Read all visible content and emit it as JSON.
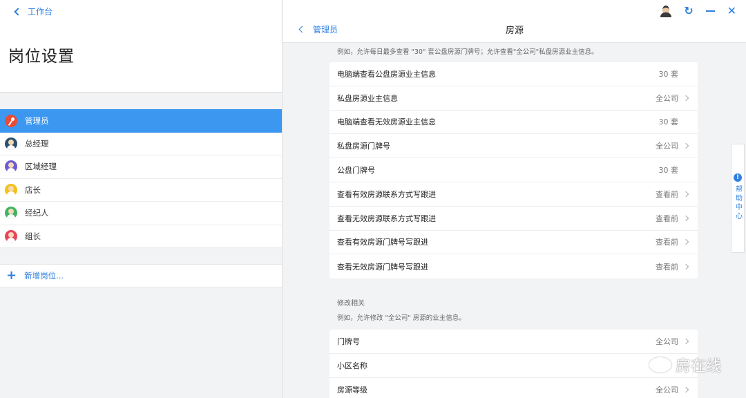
{
  "left": {
    "back_label": "工作台",
    "title": "岗位设置",
    "roles": [
      {
        "label": "管理员",
        "avatar": "key-icon",
        "active": true
      },
      {
        "label": "总经理",
        "avatar": "manager-avatar-icon",
        "active": false
      },
      {
        "label": "区域经理",
        "avatar": "area-manager-avatar-icon",
        "active": false
      },
      {
        "label": "店长",
        "avatar": "store-manager-avatar-icon",
        "active": false
      },
      {
        "label": "经纪人",
        "avatar": "agent-avatar-icon",
        "active": false
      },
      {
        "label": "组长",
        "avatar": "team-leader-avatar-icon",
        "active": false
      }
    ],
    "add_label": "新增岗位..."
  },
  "right": {
    "back_label": "管理员",
    "title": "房源",
    "hint_top": "例如，允许每日最多查看 \"30\" 套公盘房源门牌号；允许查看\"全公司\"私盘房源业主信息。",
    "view_items": [
      {
        "label": "电脑端查看公盘房源业主信息",
        "value": "30 套"
      },
      {
        "label": "私盘房源业主信息",
        "value": "全公司"
      },
      {
        "label": "电脑端查看无效房源业主信息",
        "value": "30 套"
      },
      {
        "label": "私盘房源门牌号",
        "value": "全公司"
      },
      {
        "label": "公盘门牌号",
        "value": "30 套"
      },
      {
        "label": "查看有效房源联系方式写跟进",
        "value": "查看前"
      },
      {
        "label": "查看无效房源联系方式写跟进",
        "value": "查看前"
      },
      {
        "label": "查看有效房源门牌号写跟进",
        "value": "查看前"
      },
      {
        "label": "查看无效房源门牌号写跟进",
        "value": "查看前"
      }
    ],
    "section_label": "修改相关",
    "hint_2": "例如，允许修改 \"全公司\" 房源的业主信息。",
    "edit_items": [
      {
        "label": "门牌号",
        "value": "全公司"
      },
      {
        "label": "小区名称",
        "value": ""
      },
      {
        "label": "房源等级",
        "value": "全公司"
      }
    ],
    "help_label": "帮助中心",
    "watermark": "房在线"
  },
  "colors": {
    "accent": "#2f7fe0",
    "active_row": "#3b97f0"
  }
}
